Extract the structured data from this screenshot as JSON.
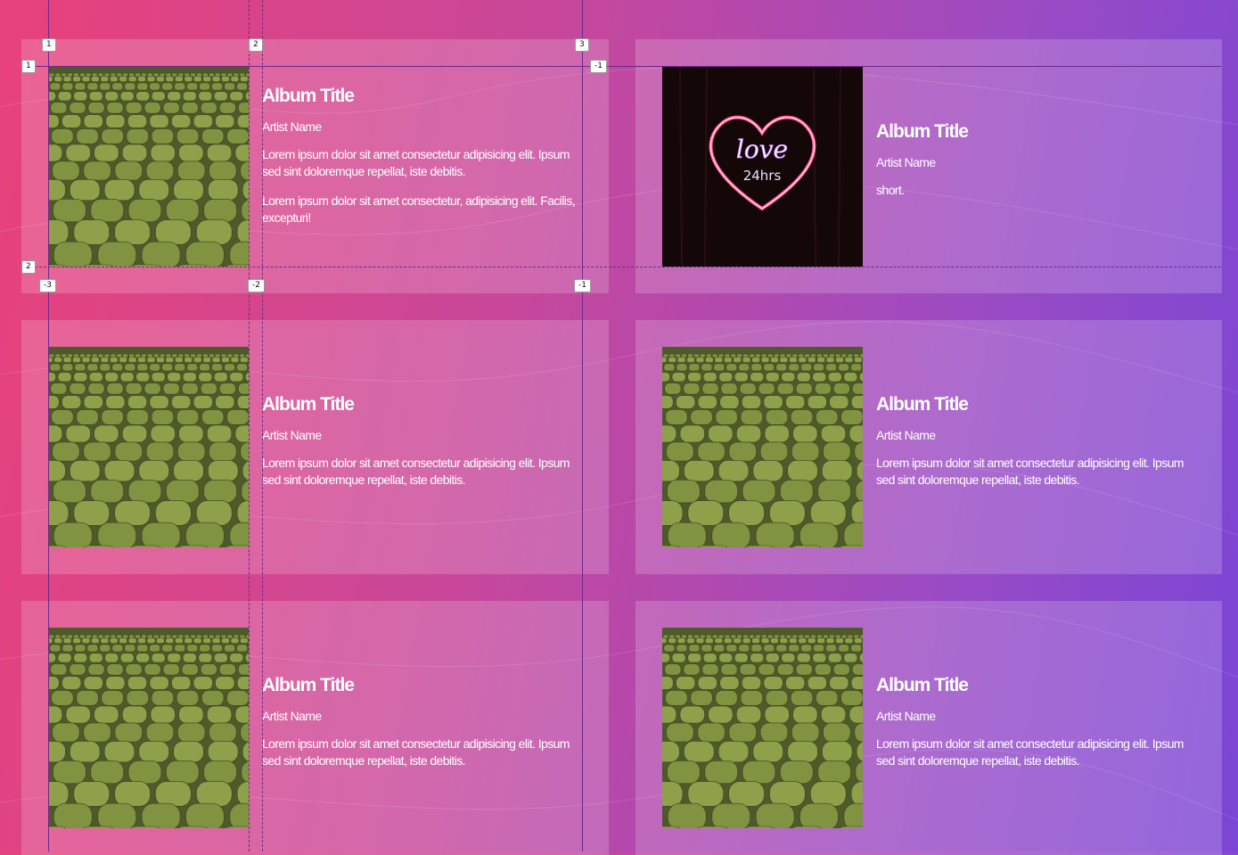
{
  "cards": [
    {
      "title": "Album Title",
      "artist": "Artist Name",
      "image": "stadium-seats",
      "paragraphs": [
        "Lorem ipsum dolor sit amet consectetur adipisicing elit. Ipsum sed sint doloremque repellat, iste debitis.",
        "Lorem ipsum dolor sit amet consectetur, adipisicing elit. Facilis, excepturi!"
      ]
    },
    {
      "title": "Album Title",
      "artist": "Artist Name",
      "image": "neon-love-sign",
      "paragraphs": [
        "short."
      ]
    },
    {
      "title": "Album Title",
      "artist": "Artist Name",
      "image": "stadium-seats",
      "paragraphs": [
        "Lorem ipsum dolor sit amet consectetur adipisicing elit. Ipsum sed sint doloremque repellat, iste debitis."
      ]
    },
    {
      "title": "Album Title",
      "artist": "Artist Name",
      "image": "stadium-seats",
      "paragraphs": [
        "Lorem ipsum dolor sit amet consectetur adipisicing elit. Ipsum sed sint doloremque repellat, iste debitis."
      ]
    },
    {
      "title": "Album Title",
      "artist": "Artist Name",
      "image": "stadium-seats",
      "paragraphs": [
        "Lorem ipsum dolor sit amet consectetur adipisicing elit. Ipsum sed sint doloremque repellat, iste debitis."
      ]
    },
    {
      "title": "Album Title",
      "artist": "Artist Name",
      "image": "stadium-seats",
      "paragraphs": [
        "Lorem ipsum dolor sit amet consectetur adipisicing elit. Ipsum sed sint doloremque repellat, iste debitis."
      ]
    }
  ],
  "neon_text": {
    "line1": "love",
    "line2": "24hrs"
  },
  "grid_badges": {
    "col_top": [
      "1",
      "2",
      "3"
    ],
    "row_left": [
      "1",
      "2"
    ],
    "col_bottom": [
      "-3",
      "-2",
      "-1"
    ],
    "row_right": [
      "-1"
    ]
  }
}
